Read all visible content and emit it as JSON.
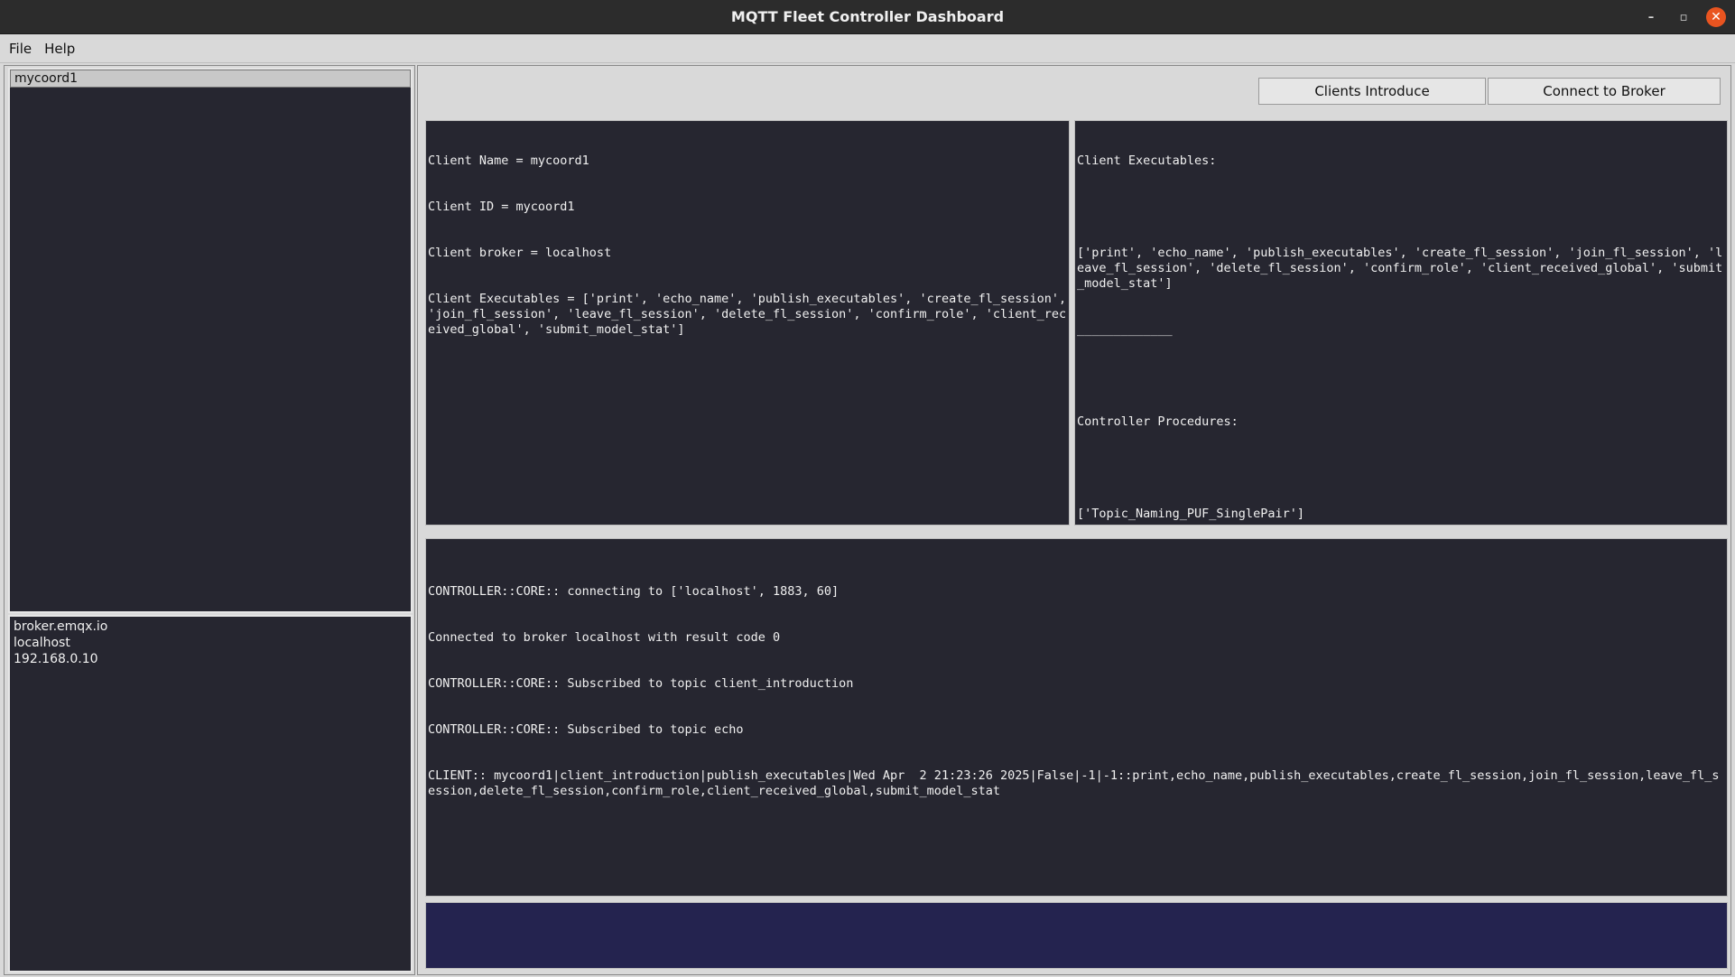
{
  "window": {
    "title": "MQTT Fleet Controller Dashboard",
    "min_glyph": "–",
    "max_glyph": "▫",
    "close_glyph": "✕"
  },
  "menu": {
    "items": [
      "File",
      "Help"
    ]
  },
  "clients": {
    "items": [
      "mycoord1"
    ],
    "selected": "mycoord1"
  },
  "brokers": {
    "items": [
      "broker.emqx.io",
      "localhost",
      "192.168.0.10"
    ]
  },
  "toolbar": {
    "clients_introduce_label": "Clients Introduce",
    "connect_broker_label": "Connect to Broker"
  },
  "client_info": {
    "lines": [
      "Client Name = mycoord1",
      "Client ID = mycoord1",
      "Client broker = localhost",
      "Client Executables = ['print', 'echo_name', 'publish_executables', 'create_fl_session', 'join_fl_session', 'leave_fl_session', 'delete_fl_session', 'confirm_role', 'client_received_global', 'submit_model_stat']"
    ]
  },
  "executables_info": {
    "executables_heading": "Client Executables:",
    "executables_value": "['print', 'echo_name', 'publish_executables', 'create_fl_session', 'join_fl_session', 'leave_fl_session', 'delete_fl_session', 'confirm_role', 'client_received_global', 'submit_model_stat']",
    "separator": "_____________",
    "procedures_heading": "Controller Procedures:",
    "procedures_value": "['Topic_Naming_PUF_SinglePair']"
  },
  "log": {
    "lines": [
      "CONTROLLER::CORE:: connecting to ['localhost', 1883, 60]",
      "Connected to broker localhost with result code 0",
      "CONTROLLER::CORE:: Subscribed to topic client_introduction",
      "CONTROLLER::CORE:: Subscribed to topic echo",
      "CLIENT:: mycoord1|client_introduction|publish_executables|Wed Apr  2 21:23:26 2025|False|-1|-1::print,echo_name,publish_executables,create_fl_session,join_fl_session,leave_fl_session,delete_fl_session,confirm_role,client_received_global,submit_model_stat"
    ]
  },
  "command": {
    "value": ""
  }
}
